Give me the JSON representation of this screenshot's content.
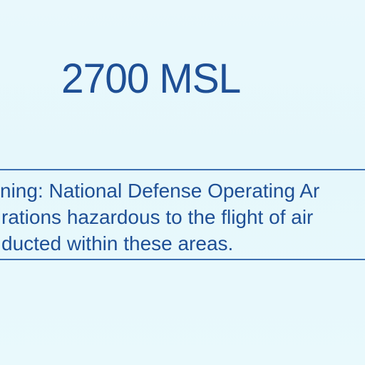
{
  "map": {
    "altitude": "2700 MSL",
    "warning": {
      "lines": [
        "ning: National Defense Operating Ar",
        "rations hazardous to the flight of air",
        "ducted within these areas."
      ]
    }
  },
  "colors": {
    "background": "#e8f8fc",
    "ink": "#1e4f95",
    "border": "#3d6fb0"
  }
}
